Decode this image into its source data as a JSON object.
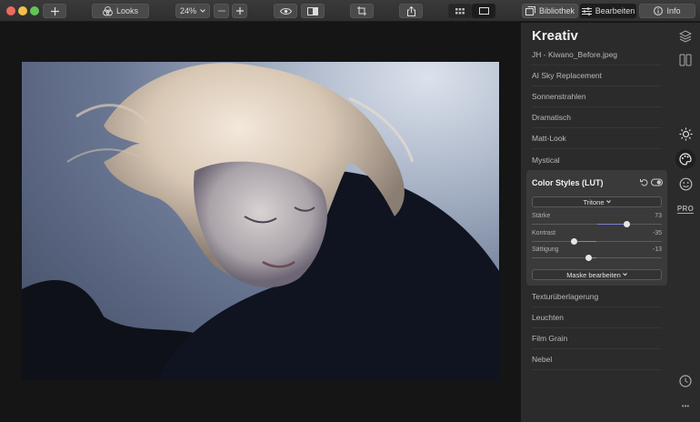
{
  "toolbar": {
    "looks_label": "Looks",
    "zoom_label": "24%",
    "bibliothek_label": "Bibliothek",
    "bearbeiten_label": "Bearbeiten",
    "info_label": "Info"
  },
  "panel": {
    "title": "Kreativ",
    "items_top": [
      "JH - Kiwano_Before.jpeg",
      "AI Sky Replacement",
      "Sonnenstrahlen",
      "Dramatisch",
      "Matt-Look",
      "Mystical"
    ],
    "items_bottom": [
      "Texturüberlagerung",
      "Leuchten",
      "Film Grain",
      "Nebel"
    ]
  },
  "color_styles": {
    "title": "Color Styles (LUT)",
    "preset": "Tritone",
    "mask_button": "Maske bearbeiten",
    "sliders": [
      {
        "label": "Stärke",
        "value": "73",
        "level": 0.73,
        "fill_color": "#7f7fd6"
      },
      {
        "label": "Kontrast",
        "value": "-35",
        "level": 0.325,
        "fill_color": "#7f7fd6"
      },
      {
        "label": "Sättigung",
        "value": "-13",
        "level": 0.435,
        "fill_color": "#d66b6b"
      }
    ]
  },
  "rail": {
    "pro_label": "PRO",
    "more_label": "•••"
  }
}
